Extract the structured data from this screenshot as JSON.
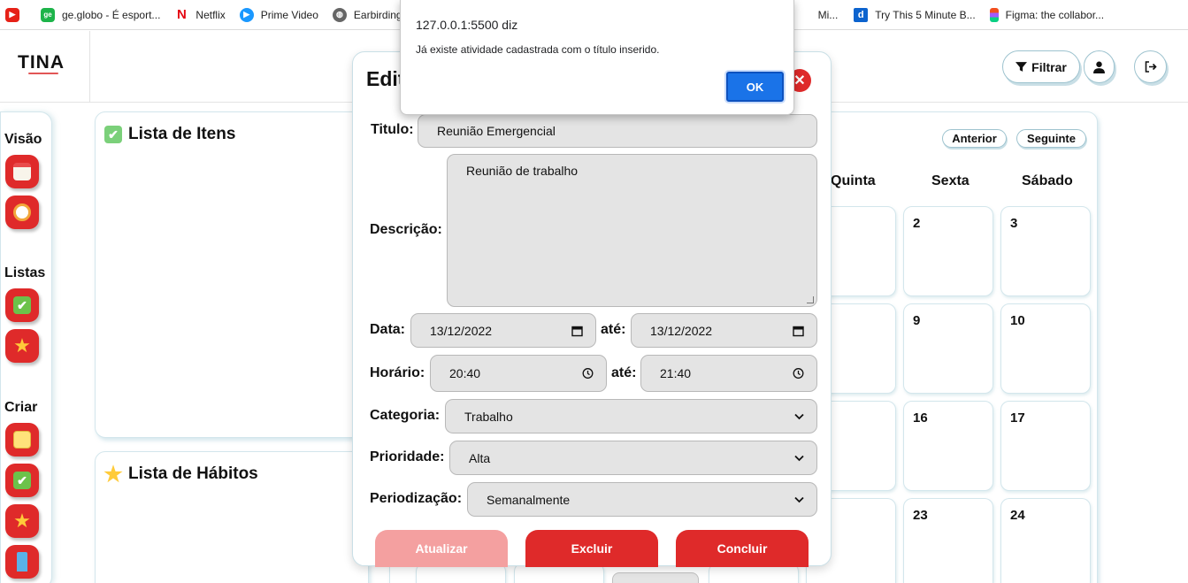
{
  "bookmarks": [
    {
      "icon": "youtube-icon",
      "label": ""
    },
    {
      "icon": "ge-globo-icon",
      "icon_text": "ge",
      "label": "ge.globo - É esport..."
    },
    {
      "icon": "netflix-icon",
      "icon_text": "N",
      "label": "Netflix"
    },
    {
      "icon": "prime-video-icon",
      "label": "Prime Video"
    },
    {
      "icon": "globe-icon",
      "label": "Earbirding"
    },
    {
      "icon": "dictionary-icon",
      "icon_text": "d",
      "label": "Try This 5 Minute B..."
    },
    {
      "icon": "figma-icon",
      "label": "Figma: the collabor..."
    }
  ],
  "bookmarks_hidden_fragment": "Mi...",
  "header": {
    "logo": "TINA",
    "filter_label": "Filtrar",
    "filter_icon": "funnel-icon",
    "user_icon": "user-icon",
    "logout_icon": "logout-icon"
  },
  "sidebar": {
    "sections": [
      {
        "title": "Visão",
        "items": [
          "calendar-icon",
          "clock-icon"
        ]
      },
      {
        "title": "Listas",
        "items": [
          "checkbox-icon",
          "star-icon"
        ]
      },
      {
        "title": "Criar",
        "items": [
          "note-icon",
          "checkbox-icon",
          "star-icon",
          "bookmark-icon"
        ]
      }
    ]
  },
  "panels": {
    "items_title": "Lista de Itens",
    "habits_title": "Lista de Hábitos"
  },
  "calendar": {
    "prev_label": "Anterior",
    "next_label": "Seguinte",
    "day_headers": [
      "Quinta",
      "Sexta",
      "Sábado"
    ],
    "visible_dates": [
      [
        "",
        "2",
        "3"
      ],
      [
        "",
        "9",
        "10"
      ],
      [
        "",
        "16",
        "17"
      ],
      [
        "",
        "23",
        "24"
      ]
    ]
  },
  "modal": {
    "title": "Edit",
    "close_label": "✕",
    "fields": {
      "titulo_label": "Titulo:",
      "titulo_value": "Reunião Emergencial",
      "descricao_label": "Descrição:",
      "descricao_value": "Reunião de trabalho",
      "data_label": "Data:",
      "data_start": "13/12/2022",
      "ate_label": "até:",
      "data_end": "13/12/2022",
      "horario_label": "Horário:",
      "horario_start": "20:40",
      "horario_end": "21:40",
      "categoria_label": "Categoria:",
      "categoria_value": "Trabalho",
      "prioridade_label": "Prioridade:",
      "prioridade_value": "Alta",
      "periodizacao_label": "Periodização:",
      "periodizacao_value": "Semanalmente"
    },
    "buttons": {
      "update_label": "Atualizar",
      "delete_label": "Excluir",
      "complete_label": "Concluir"
    }
  },
  "alert": {
    "title": "127.0.0.1:5500 diz",
    "message": "Já existe atividade cadastrada com o título inserido.",
    "ok_label": "OK"
  },
  "colors": {
    "primary_red": "#df2a2a",
    "disabled_red": "#f4a0a0",
    "accent_border": "#9ec3cf",
    "ok_blue": "#1a73e8"
  }
}
